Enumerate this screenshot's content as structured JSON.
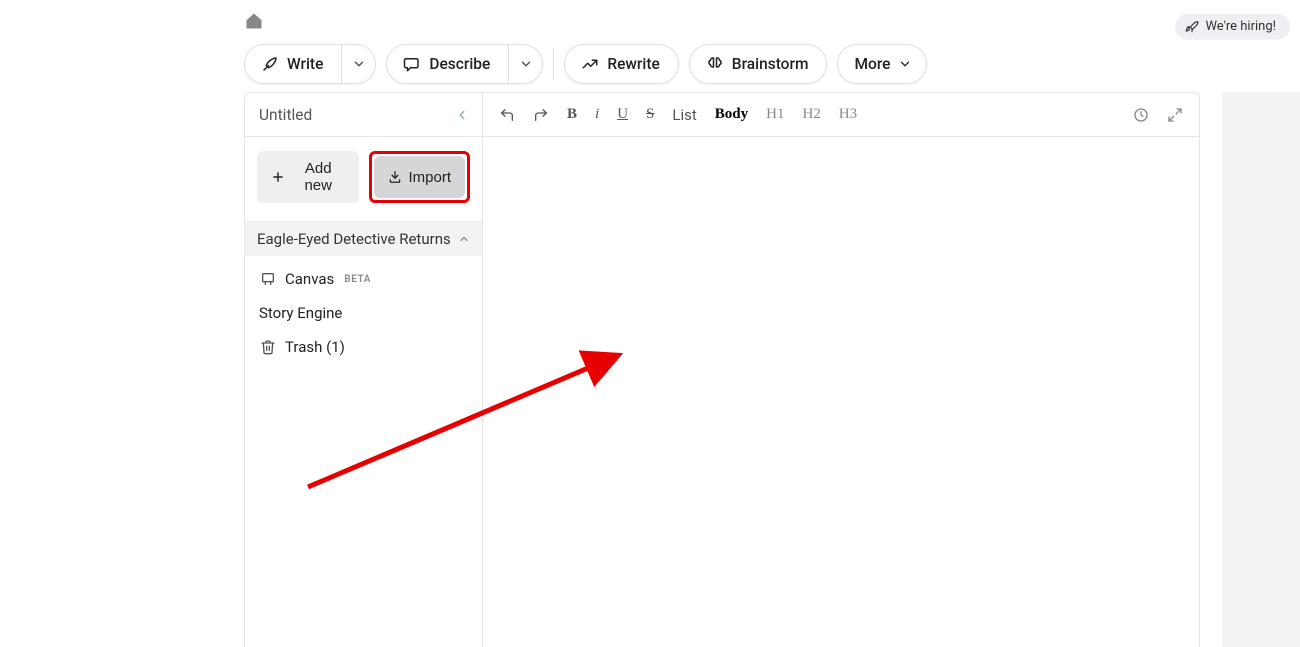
{
  "header": {
    "hiring_label": "We're hiring!"
  },
  "toolbar": {
    "write_label": "Write",
    "describe_label": "Describe",
    "rewrite_label": "Rewrite",
    "brainstorm_label": "Brainstorm",
    "more_label": "More"
  },
  "sidebar": {
    "title": "Untitled",
    "add_new_label": "Add new",
    "import_label": "Import",
    "project_title": "Eagle-Eyed Detective Returns",
    "items": [
      {
        "label": "Canvas",
        "badge": "BETA"
      },
      {
        "label": "Story Engine"
      },
      {
        "label": "Trash (1)"
      }
    ]
  },
  "editor_toolbar": {
    "list_label": "List",
    "body_label": "Body",
    "h1_label": "H1",
    "h2_label": "H2",
    "h3_label": "H3"
  }
}
